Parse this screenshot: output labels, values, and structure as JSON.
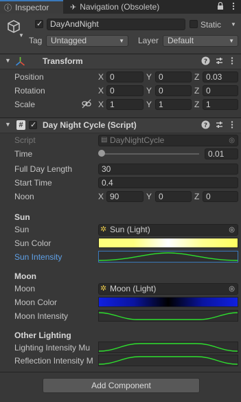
{
  "tabs": [
    {
      "label": "Inspector"
    },
    {
      "label": "Navigation (Obsolete)"
    }
  ],
  "gameobject": {
    "name": "DayAndNight",
    "static_label": "Static",
    "tag_label": "Tag",
    "tag_value": "Untagged",
    "layer_label": "Layer",
    "layer_value": "Default"
  },
  "transform": {
    "title": "Transform",
    "rows": [
      {
        "label": "Position",
        "x": "0",
        "y": "0",
        "z": "0.03"
      },
      {
        "label": "Rotation",
        "x": "0",
        "y": "0",
        "z": "0"
      },
      {
        "label": "Scale",
        "x": "1",
        "y": "1",
        "z": "1"
      }
    ]
  },
  "script": {
    "title": "Day Night Cycle (Script)",
    "script_label": "Script",
    "script_value": "DayNightCycle",
    "time_label": "Time",
    "time_value": "0.01",
    "time_fraction": 0.01,
    "full_day_label": "Full Day Length",
    "full_day_value": "30",
    "start_time_label": "Start Time",
    "start_time_value": "0.4",
    "noon_label": "Noon",
    "noon_x": "90",
    "noon_y": "0",
    "noon_z": "0",
    "sun_section": "Sun",
    "sun_label": "Sun",
    "sun_value": "Sun (Light)",
    "sun_color_label": "Sun Color",
    "sun_intensity_label": "Sun Intensity",
    "moon_section": "Moon",
    "moon_label": "Moon",
    "moon_value": "Moon (Light)",
    "moon_color_label": "Moon Color",
    "moon_intensity_label": "Moon Intensity",
    "other_section": "Other Lighting",
    "lighting_mult_label": "Lighting Intensity Mu",
    "reflection_mult_label": "Reflection Intensity M"
  },
  "axes": {
    "x": "X",
    "y": "Y",
    "z": "Z"
  },
  "add_component": "Add Component",
  "colors": {
    "accent_blue": "#3a79bb",
    "highlight_label": "#5fa0e6",
    "curve_green": "#2ee02e",
    "sun_gradient": [
      "#ffff7a",
      "#ffffff",
      "#ffff60"
    ],
    "moon_gradient": [
      "#1020e0",
      "#000000",
      "#1020e0"
    ]
  },
  "icons": [
    "gameobject-cube-icon",
    "lock-icon",
    "menu-icon",
    "transform-axes-icon",
    "script-hash-icon",
    "help-icon",
    "settings-icon",
    "more-icon",
    "link-icon",
    "target-icon",
    "light-icon"
  ]
}
